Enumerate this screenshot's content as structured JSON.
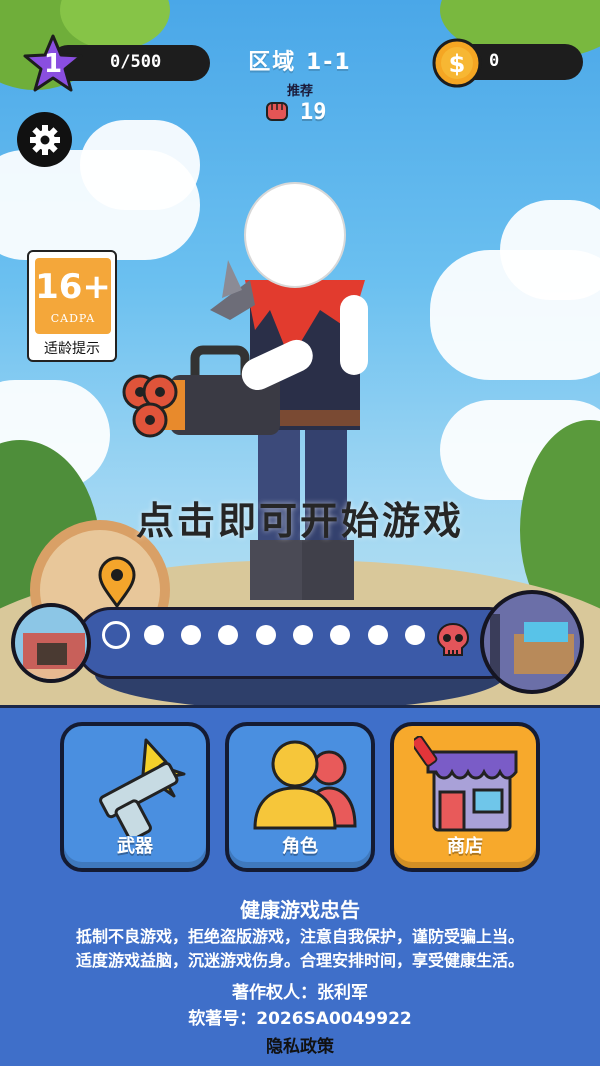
{
  "hud": {
    "level": "1",
    "xp_text": "0/500",
    "zone_title": "区域 1-1",
    "recommend_label": "推荐",
    "recommend_power": "19",
    "coins": "0"
  },
  "age_rating": {
    "number": "16+",
    "org": "CADPA",
    "hint": "适龄提示"
  },
  "start_prompt": "点击即可开始游戏",
  "progress": {
    "current_stage": 1,
    "total_stages": 10
  },
  "menu": {
    "weapons": "武器",
    "characters": "角色",
    "shop": "商店"
  },
  "notice": {
    "title": "健康游戏忠告",
    "line1": "抵制不良游戏，拒绝盗版游戏，注意自我保护，谨防受骗上当。",
    "line2": "适度游戏益脑，沉迷游戏伤身。合理安排时间，享受健康生活。"
  },
  "copyright": {
    "owner": "著作权人：张利军",
    "reg_no": "软著号：2026SA0049922"
  },
  "privacy": "隐私政策",
  "colors": {
    "panel": "#3f6fc9",
    "button_blue": "#4a8fe0",
    "button_active": "#f7a92c",
    "star": "#8a4ee0",
    "coin": "#f5a623"
  }
}
